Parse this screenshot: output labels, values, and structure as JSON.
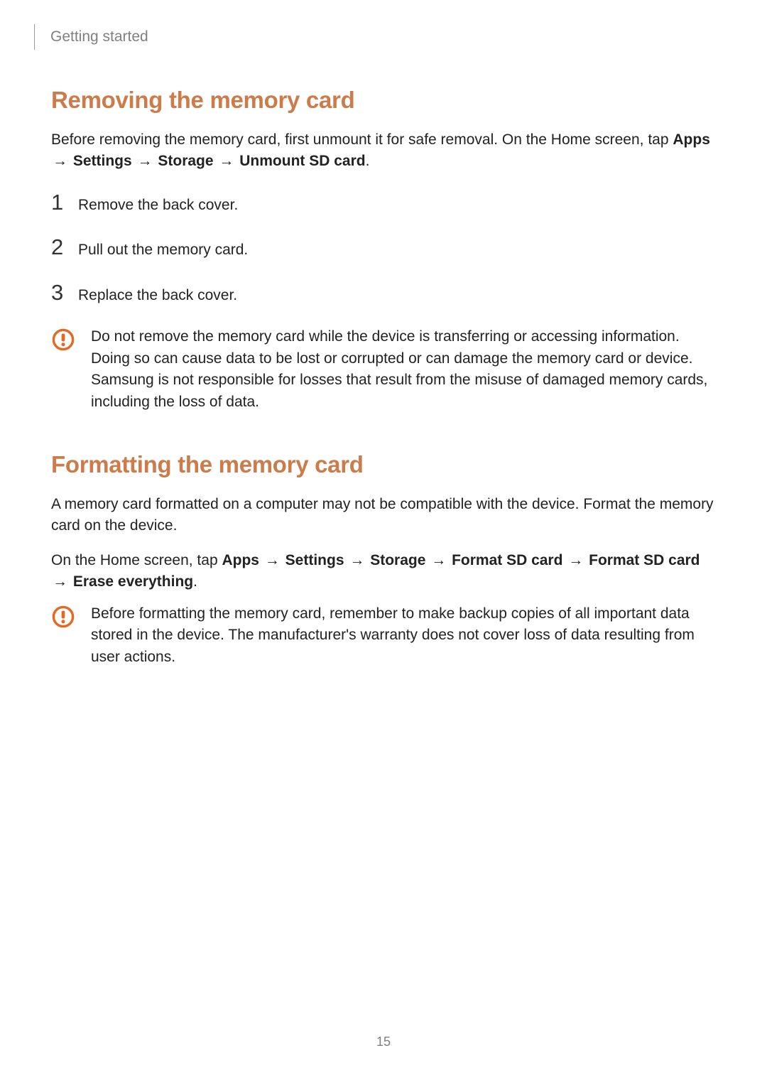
{
  "chapter": "Getting started",
  "section1": {
    "title": "Removing the memory card",
    "intro_lead": "Before removing the memory card, first unmount it for safe removal. On the Home screen, tap ",
    "path": [
      "Apps",
      "Settings",
      "Storage",
      "Unmount SD card"
    ],
    "period": ".",
    "steps": [
      {
        "n": "1",
        "text": "Remove the back cover."
      },
      {
        "n": "2",
        "text": "Pull out the memory card."
      },
      {
        "n": "3",
        "text": "Replace the back cover."
      }
    ],
    "caution": "Do not remove the memory card while the device is transferring or accessing information. Doing so can cause data to be lost or corrupted or can damage the memory card or device. Samsung is not responsible for losses that result from the misuse of damaged memory cards, including the loss of data."
  },
  "section2": {
    "title": "Formatting the memory card",
    "para1": "A memory card formatted on a computer may not be compatible with the device. Format the memory card on the device.",
    "para2_lead": "On the Home screen, tap ",
    "path": [
      "Apps",
      "Settings",
      "Storage",
      "Format SD card",
      "Format SD card",
      "Erase everything"
    ],
    "period": ".",
    "caution": "Before formatting the memory card, remember to make backup copies of all important data stored in the device. The manufacturer's warranty does not cover loss of data resulting from user actions."
  },
  "arrow": "→",
  "page_number": "15",
  "icon": {
    "color": "#e36a23",
    "name": "caution-icon"
  }
}
